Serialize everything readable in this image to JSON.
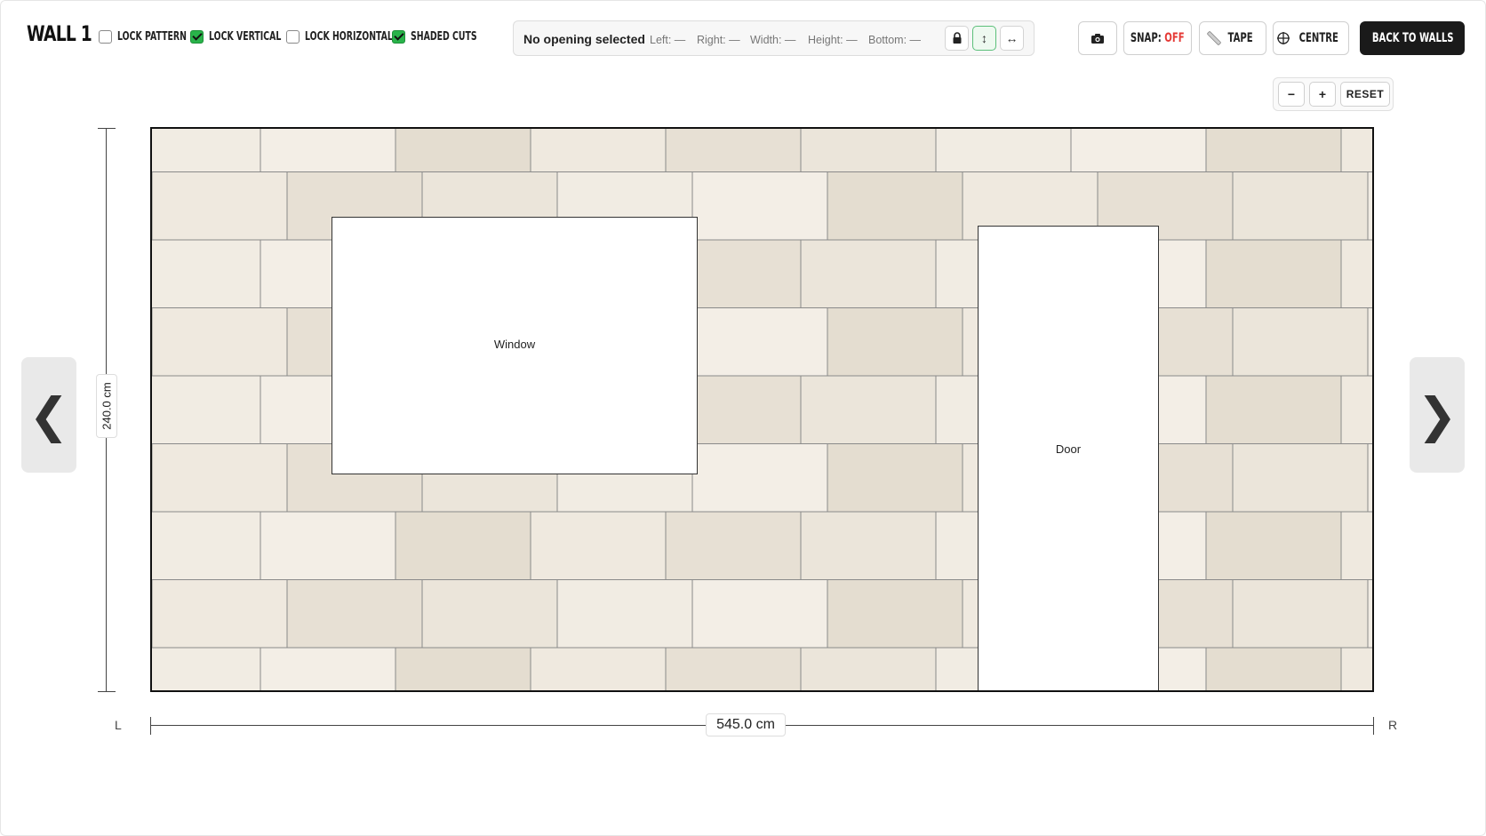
{
  "header": {
    "wall_title": "WALL 1",
    "checkboxes": [
      {
        "label": "Lock Pattern",
        "checked": false
      },
      {
        "label": "Lock Vertical",
        "checked": true
      },
      {
        "label": "Lock Horizontal",
        "checked": false
      },
      {
        "label": "Shaded Cuts",
        "checked": true
      }
    ]
  },
  "info_bar": {
    "selection_text": "No opening selected",
    "fields": [
      "Left: —",
      "Right: —",
      "Width: —",
      "Height: —",
      "Bottom: —"
    ],
    "buttons": [
      {
        "icon": "lock-icon",
        "glyph": "🔒",
        "active": false
      },
      {
        "icon": "vertical-arrows-icon",
        "glyph": "↕",
        "active": true
      },
      {
        "icon": "horizontal-arrows-icon",
        "glyph": "↔",
        "active": false
      }
    ]
  },
  "toolbar": {
    "camera_icon": "camera-icon",
    "snap_label": "SNAP:",
    "snap_state": "OFF",
    "tape_label": "TAPE",
    "centre_label": "CENTRE",
    "back_label": "BACK TO WALLS"
  },
  "zoom": {
    "minus": "−",
    "plus": "+",
    "reset": "RESET"
  },
  "nav": {
    "prev": "❮",
    "next": "❯"
  },
  "wall": {
    "tile_color": "#ede7dc",
    "grout_color": "#8a8a8a",
    "openings": [
      {
        "label": "Window"
      },
      {
        "label": "Door"
      }
    ]
  },
  "dimensions": {
    "height": "240.0 cm",
    "width": "545.0 cm",
    "left_label": "L",
    "right_label": "R"
  },
  "colors": {
    "accent_green": "#29b34a",
    "snap_off_red": "#e53935",
    "dark_button": "#1a1a1a"
  }
}
